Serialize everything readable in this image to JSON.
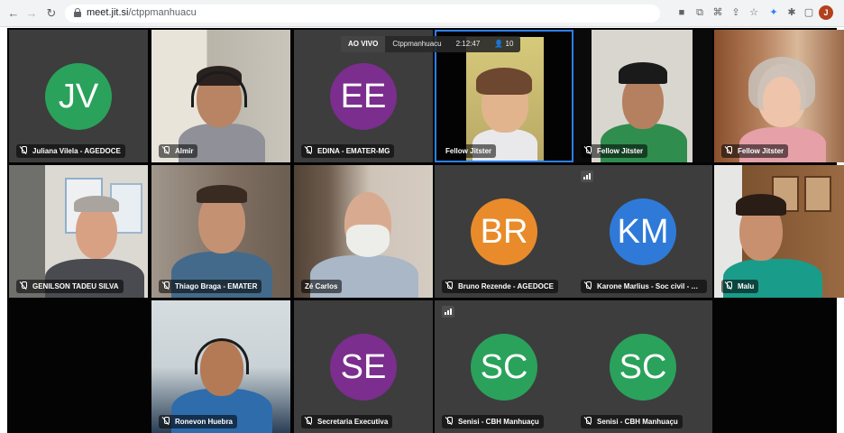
{
  "browser": {
    "url_host": "meet.jit.si",
    "url_path": "/ctppmanhuacu",
    "profile_initial": "J"
  },
  "meeting": {
    "logo": "jitsi",
    "live_label": "AO VIVO",
    "room_name": "Ctppmanhuacu",
    "timer": "2:12:47",
    "participant_count": "10"
  },
  "participants": [
    {
      "name": "Juliana Vilela - AGEDOCE",
      "initials": "JV",
      "avatar_color": "#2aa25b"
    },
    {
      "name": "Almir",
      "initials": "",
      "avatar_color": ""
    },
    {
      "name": "EDINA - EMATER-MG",
      "initials": "EE",
      "avatar_color": "#7b2e8e"
    },
    {
      "name": "Fellow Jitster",
      "initials": "",
      "avatar_color": ""
    },
    {
      "name": "Fellow Jitster",
      "initials": "",
      "avatar_color": ""
    },
    {
      "name": "Fellow Jitster",
      "initials": "",
      "avatar_color": ""
    },
    {
      "name": "GENILSON TADEU SILVA",
      "initials": "",
      "avatar_color": ""
    },
    {
      "name": "Thiago Braga - EMATER",
      "initials": "",
      "avatar_color": ""
    },
    {
      "name": "Zé Carlos",
      "initials": "",
      "avatar_color": ""
    },
    {
      "name": "Bruno Rezende - AGEDOCE",
      "initials": "BR",
      "avatar_color": "#e98b2a"
    },
    {
      "name": "Karone Marlius - Soc civil - Associação",
      "initials": "KM",
      "avatar_color": "#2f7ad8"
    },
    {
      "name": "Malu",
      "initials": "",
      "avatar_color": ""
    },
    {
      "name": "Ronevon Huebra",
      "initials": "",
      "avatar_color": ""
    },
    {
      "name": "Secretaria Executiva",
      "initials": "SE",
      "avatar_color": "#7b2e8e"
    },
    {
      "name": "Senisi - CBH Manhuaçu",
      "initials": "SC",
      "avatar_color": "#2aa25b"
    },
    {
      "name": "Senisi - CBH Manhuaçu",
      "initials": "SC",
      "avatar_color": "#2aa25b"
    }
  ]
}
